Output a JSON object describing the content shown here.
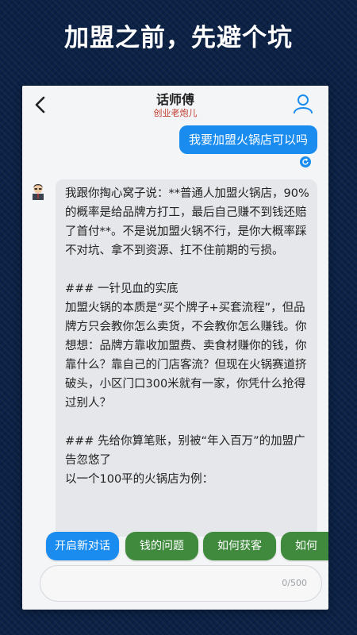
{
  "headline": "加盟之前，先避个坑",
  "header": {
    "title": "话师傅",
    "subtitle": "创业老炮儿"
  },
  "chat": {
    "user_message": "我要加盟火锅店可以吗",
    "bot_message": "我跟你掏心窝子说：**普通人加盟火锅店，90%的概率是给品牌方打工，最后自己赚不到钱还赔了首付**。不是说加盟火锅不行，是你大概率踩不对坑、拿不到资源、扛不住前期的亏损。\n\n### 一针见血的实底\n加盟火锅的本质是“买个牌子+买套流程”，但品牌方只会教你怎么卖货，不会教你怎么赚钱。你想想：品牌方靠收加盟费、卖食材赚你的钱，你靠什么？靠自己的门店客流？但现在火锅赛道挤破头，小区门口300米就有一家，你凭什么抢得过别人？\n\n### 先给你算笔账，别被“年入百万”的加盟广告忽悠了\n以一个100平的火锅店为例："
  },
  "quick_replies": {
    "new_chat": "开启新对话",
    "money": "钱的问题",
    "customers": "如何获客",
    "more": "如何"
  },
  "input": {
    "placeholder": "",
    "counter": "0/500"
  },
  "colors": {
    "background": "#0b2145",
    "accent_blue": "#1a8cf0",
    "chip_green": "#3f8a3d",
    "subtitle_red": "#c0392b"
  },
  "icons": {
    "back": "back-arrow-icon",
    "user": "user-profile-icon",
    "refresh": "refresh-icon",
    "avatar": "bot-avatar"
  }
}
